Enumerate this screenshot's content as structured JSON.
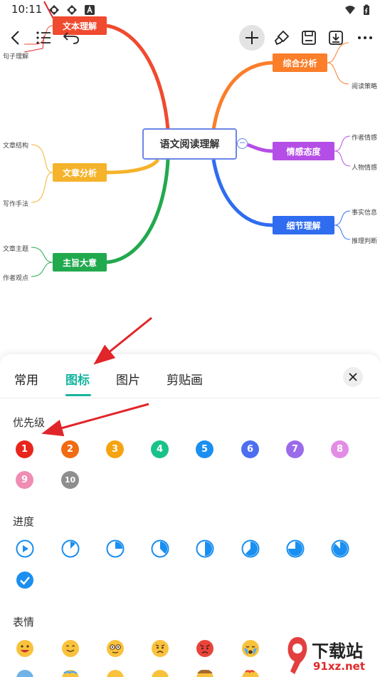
{
  "status_bar": {
    "time": "10:11"
  },
  "mindmap": {
    "root": "语文阅读理解",
    "branches": [
      {
        "label": "文本理解",
        "color": "#f04a2f",
        "leaves": [
          "句子理解"
        ]
      },
      {
        "label": "综合分析",
        "color": "#fb7e2a",
        "leaves": [
          "阅读策略"
        ]
      },
      {
        "label": "文章分析",
        "color": "#f5b32b",
        "leaves": [
          "文章结构",
          "写作手法"
        ]
      },
      {
        "label": "情感态度",
        "color": "#b54ee6",
        "leaves": [
          "作者情感",
          "人物情感"
        ]
      },
      {
        "label": "细节理解",
        "color": "#2f6cf0",
        "leaves": [
          "事实信息",
          "推理判断"
        ]
      },
      {
        "label": "主旨大意",
        "color": "#21a94e",
        "leaves": [
          "文章主题",
          "作者观点"
        ]
      }
    ]
  },
  "panel": {
    "tabs": [
      "常用",
      "图标",
      "图片",
      "剪贴画"
    ],
    "active_tab": "图标",
    "sections": {
      "priority": {
        "title": "优先级",
        "items": [
          "1",
          "2",
          "3",
          "4",
          "5",
          "6",
          "7",
          "8",
          "9",
          "10"
        ]
      },
      "progress": {
        "title": "进度"
      },
      "emoji": {
        "title": "表情"
      }
    }
  },
  "colors": {
    "accent": "#17b5a0",
    "priority": [
      "#e8261c",
      "#f26b13",
      "#f5a30f",
      "#19c28b",
      "#1a8ff0",
      "#4d6ef0",
      "#9b6bea",
      "#e38ce6",
      "#f08db2",
      "#8e8e8e"
    ],
    "progress_blue": "#1a8ff0"
  },
  "icons": [
    "back-icon",
    "outline-list-icon",
    "undo-icon",
    "add-node-icon",
    "style-brush-icon",
    "save-icon",
    "export-icon",
    "more-icon",
    "close-icon"
  ],
  "watermark": {
    "brand": "下载站",
    "domain": "91xz.net"
  }
}
